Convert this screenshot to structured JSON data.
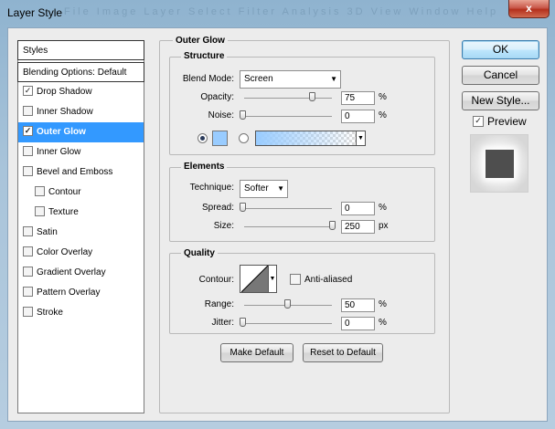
{
  "window": {
    "title": "Layer Style",
    "close_glyph": "x",
    "ghost_menu": "File  Image  Layer  Select  Filter  Analysis  3D  View  Window  Help"
  },
  "styles_list": {
    "header": "Styles",
    "blending": "Blending Options: Default",
    "items": [
      {
        "label": "Drop Shadow",
        "checked": true
      },
      {
        "label": "Inner Shadow",
        "checked": false
      },
      {
        "label": "Outer Glow",
        "checked": true,
        "selected": true
      },
      {
        "label": "Inner Glow",
        "checked": false
      },
      {
        "label": "Bevel and Emboss",
        "checked": false
      },
      {
        "label": "Contour",
        "checked": false,
        "indent": true
      },
      {
        "label": "Texture",
        "checked": false,
        "indent": true
      },
      {
        "label": "Satin",
        "checked": false
      },
      {
        "label": "Color Overlay",
        "checked": false
      },
      {
        "label": "Gradient Overlay",
        "checked": false
      },
      {
        "label": "Pattern Overlay",
        "checked": false
      },
      {
        "label": "Stroke",
        "checked": false
      }
    ]
  },
  "outer_glow": {
    "title": "Outer Glow",
    "structure": {
      "title": "Structure",
      "blend_mode_label": "Blend Mode:",
      "blend_mode": "Screen",
      "opacity_label": "Opacity:",
      "opacity": "75",
      "opacity_unit": "%",
      "noise_label": "Noise:",
      "noise": "0",
      "noise_unit": "%",
      "glow_color": "#99ccff"
    },
    "elements": {
      "title": "Elements",
      "technique_label": "Technique:",
      "technique": "Softer",
      "spread_label": "Spread:",
      "spread": "0",
      "spread_unit": "%",
      "size_label": "Size:",
      "size": "250",
      "size_unit": "px"
    },
    "quality": {
      "title": "Quality",
      "contour_label": "Contour:",
      "anti_aliased_label": "Anti-aliased",
      "range_label": "Range:",
      "range": "50",
      "range_unit": "%",
      "jitter_label": "Jitter:",
      "jitter": "0",
      "jitter_unit": "%"
    },
    "make_default": "Make Default",
    "reset_default": "Reset to Default"
  },
  "actions": {
    "ok": "OK",
    "cancel": "Cancel",
    "new_style": "New Style...",
    "preview_label": "Preview",
    "preview_checked": true
  }
}
